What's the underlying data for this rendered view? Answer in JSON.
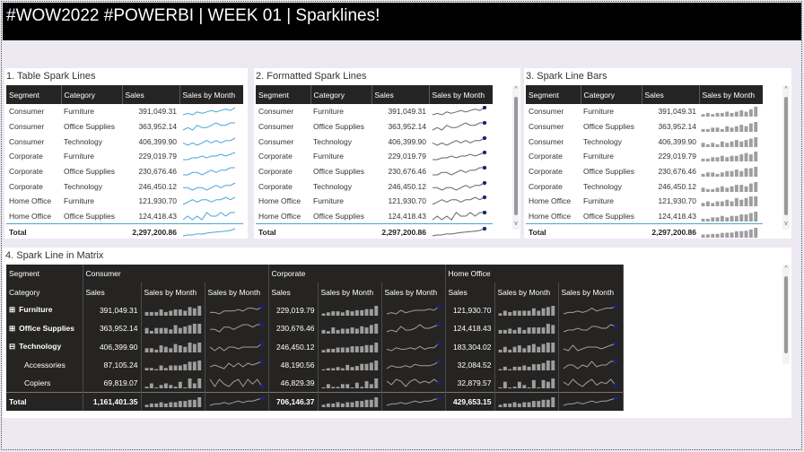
{
  "header": {
    "title": "#WOW2022 #POWERBI | WEEK 01 | Sparklines!"
  },
  "table1": {
    "title": "1. Table Spark Lines",
    "columns": [
      "Segment",
      "Category",
      "Sales",
      "Sales by Month"
    ],
    "rows": [
      {
        "segment": "Consumer",
        "category": "Furniture",
        "sales": "391,049.31",
        "spark": [
          3,
          4,
          3,
          5,
          4,
          5,
          6,
          5,
          6,
          7,
          6,
          8
        ]
      },
      {
        "segment": "Consumer",
        "category": "Office Supplies",
        "sales": "363,952.14",
        "spark": [
          4,
          5,
          4,
          6,
          5,
          5,
          6,
          7,
          6,
          6,
          7,
          7
        ]
      },
      {
        "segment": "Consumer",
        "category": "Technology",
        "sales": "406,399.90",
        "spark": [
          5,
          4,
          5,
          4,
          5,
          6,
          5,
          6,
          5,
          6,
          6,
          7
        ]
      },
      {
        "segment": "Corporate",
        "category": "Furniture",
        "sales": "229,019.79",
        "spark": [
          3,
          3,
          4,
          4,
          5,
          4,
          5,
          5,
          6,
          5,
          6,
          7
        ]
      },
      {
        "segment": "Corporate",
        "category": "Office Supplies",
        "sales": "230,676.46",
        "spark": [
          4,
          4,
          5,
          5,
          4,
          5,
          6,
          5,
          6,
          6,
          7,
          7
        ]
      },
      {
        "segment": "Corporate",
        "category": "Technology",
        "sales": "246,450.12",
        "spark": [
          5,
          5,
          4,
          5,
          5,
          4,
          5,
          6,
          5,
          6,
          6,
          7
        ]
      },
      {
        "segment": "Home Office",
        "category": "Furniture",
        "sales": "121,930.70",
        "spark": [
          3,
          4,
          5,
          4,
          5,
          5,
          4,
          5,
          5,
          6,
          5,
          6
        ]
      },
      {
        "segment": "Home Office",
        "category": "Office Supplies",
        "sales": "124,418.43",
        "spark": [
          4,
          5,
          4,
          5,
          4,
          6,
          5,
          5,
          6,
          5,
          6,
          6
        ]
      }
    ],
    "total_label": "Total",
    "total_sales": "2,297,200.86"
  },
  "table2": {
    "title": "2. Formatted Spark Lines",
    "columns": [
      "Segment",
      "Category",
      "Sales",
      "Sales by Month"
    ],
    "rows": [
      {
        "segment": "Consumer",
        "category": "Furniture",
        "sales": "391,049.31",
        "spark": [
          3,
          4,
          3,
          5,
          4,
          5,
          6,
          5,
          6,
          7,
          6,
          8
        ]
      },
      {
        "segment": "Consumer",
        "category": "Office Supplies",
        "sales": "363,952.14",
        "spark": [
          4,
          5,
          4,
          6,
          5,
          5,
          6,
          7,
          6,
          6,
          7,
          7
        ]
      },
      {
        "segment": "Consumer",
        "category": "Technology",
        "sales": "406,399.90",
        "spark": [
          5,
          4,
          5,
          4,
          5,
          6,
          5,
          6,
          5,
          6,
          6,
          7
        ]
      },
      {
        "segment": "Corporate",
        "category": "Furniture",
        "sales": "229,019.79",
        "spark": [
          3,
          3,
          4,
          4,
          5,
          4,
          5,
          5,
          6,
          5,
          6,
          7
        ]
      },
      {
        "segment": "Corporate",
        "category": "Office Supplies",
        "sales": "230,676.46",
        "spark": [
          4,
          4,
          5,
          5,
          4,
          5,
          6,
          5,
          6,
          6,
          7,
          7
        ]
      },
      {
        "segment": "Corporate",
        "category": "Technology",
        "sales": "246,450.12",
        "spark": [
          5,
          5,
          4,
          5,
          5,
          4,
          5,
          6,
          5,
          6,
          6,
          7
        ]
      },
      {
        "segment": "Home Office",
        "category": "Furniture",
        "sales": "121,930.70",
        "spark": [
          3,
          4,
          5,
          4,
          5,
          5,
          4,
          5,
          5,
          6,
          5,
          6
        ]
      },
      {
        "segment": "Home Office",
        "category": "Office Supplies",
        "sales": "124,418.43",
        "spark": [
          4,
          5,
          4,
          5,
          4,
          6,
          5,
          5,
          6,
          5,
          6,
          6
        ]
      }
    ],
    "total_label": "Total",
    "total_sales": "2,297,200.86"
  },
  "table3": {
    "title": "3. Spark Line Bars",
    "columns": [
      "Segment",
      "Category",
      "Sales",
      "Sales by Month"
    ],
    "rows": [
      {
        "segment": "Consumer",
        "category": "Furniture",
        "sales": "391,049.31",
        "spark": [
          2,
          3,
          2,
          3,
          3,
          4,
          3,
          4,
          5,
          4,
          6,
          8
        ]
      },
      {
        "segment": "Consumer",
        "category": "Office Supplies",
        "sales": "363,952.14",
        "spark": [
          2,
          2,
          3,
          3,
          2,
          4,
          3,
          4,
          5,
          4,
          6,
          7
        ]
      },
      {
        "segment": "Consumer",
        "category": "Technology",
        "sales": "406,399.90",
        "spark": [
          3,
          2,
          3,
          2,
          4,
          3,
          4,
          5,
          4,
          5,
          6,
          7
        ]
      },
      {
        "segment": "Corporate",
        "category": "Furniture",
        "sales": "229,019.79",
        "spark": [
          2,
          2,
          3,
          3,
          4,
          3,
          4,
          4,
          5,
          6,
          5,
          7
        ]
      },
      {
        "segment": "Corporate",
        "category": "Office Supplies",
        "sales": "230,676.46",
        "spark": [
          2,
          3,
          3,
          2,
          3,
          4,
          4,
          5,
          4,
          6,
          6,
          7
        ]
      },
      {
        "segment": "Corporate",
        "category": "Technology",
        "sales": "246,450.12",
        "spark": [
          3,
          2,
          2,
          3,
          4,
          3,
          4,
          5,
          5,
          4,
          6,
          7
        ]
      },
      {
        "segment": "Home Office",
        "category": "Furniture",
        "sales": "121,930.70",
        "spark": [
          2,
          3,
          2,
          3,
          3,
          4,
          3,
          5,
          4,
          5,
          6,
          6
        ]
      },
      {
        "segment": "Home Office",
        "category": "Office Supplies",
        "sales": "124,418.43",
        "spark": [
          2,
          2,
          3,
          3,
          4,
          3,
          4,
          4,
          5,
          5,
          6,
          7
        ]
      }
    ],
    "total_label": "Total",
    "total_sales": "2,297,200.86"
  },
  "matrix": {
    "title": "4. Spark Line in Matrix",
    "row_header_segment": "Segment",
    "row_header_category": "Category",
    "segments": [
      "Consumer",
      "Corporate",
      "Home Office"
    ],
    "value_headers": [
      "Sales",
      "Sales by Month",
      "Sales by Month"
    ],
    "rows": [
      {
        "label": "Furniture",
        "expander": "⊞",
        "level": 0,
        "values": [
          "391,049.31",
          "229,019.79",
          "121,930.70"
        ]
      },
      {
        "label": "Office Supplies",
        "expander": "⊞",
        "level": 0,
        "values": [
          "363,952.14",
          "230,676.46",
          "124,418.43"
        ]
      },
      {
        "label": "Technology",
        "expander": "⊟",
        "level": 0,
        "values": [
          "406,399.90",
          "246,450.12",
          "183,304.02"
        ]
      },
      {
        "label": "Accessories",
        "expander": "",
        "level": 1,
        "values": [
          "87,105.24",
          "48,190.56",
          "32,084.52"
        ]
      },
      {
        "label": "Copiers",
        "expander": "",
        "level": 1,
        "values": [
          "69,819.07",
          "46,829.39",
          "32,879.57"
        ]
      }
    ],
    "total_label": "Total",
    "total_values": [
      "1,161,401.35",
      "706,146.37",
      "429,653.15"
    ]
  },
  "colors": {
    "header_bg": "#252423",
    "spark_line_light": "#4aa6d6",
    "spark_line_dark": "#666666",
    "spark_marker": "#1a237e",
    "spark_bar": "#9e9e9e",
    "title_bar": "#000000"
  }
}
